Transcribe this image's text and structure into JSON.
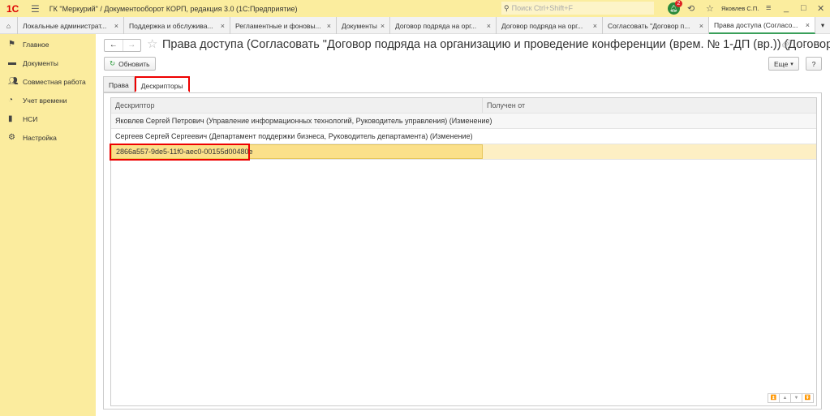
{
  "app": {
    "logo": "1С",
    "title": "ГК \"Меркурий\" / Документооборот КОРП, редакция 3.0  (1С:Предприятие)",
    "search_placeholder": "Поиск Ctrl+Shift+F",
    "notifications": "2",
    "user": "Яковлев С.П."
  },
  "tabs": [
    {
      "label": "Локальные администрат..."
    },
    {
      "label": "Поддержка и обслужива..."
    },
    {
      "label": "Регламентные и фоновы..."
    },
    {
      "label": "Документы"
    },
    {
      "label": "Договор подряда на орг..."
    },
    {
      "label": "Договор подряда на орг..."
    },
    {
      "label": "Согласовать \"Договор п..."
    },
    {
      "label": "Права доступа (Согласо..."
    }
  ],
  "sidebar": {
    "items": [
      {
        "label": "Главное"
      },
      {
        "label": "Документы"
      },
      {
        "label": "Совместная работа"
      },
      {
        "label": "Учет времени"
      },
      {
        "label": "НСИ"
      },
      {
        "label": "Настройка"
      }
    ]
  },
  "page": {
    "title": "Права доступа (Согласовать \"Договор подряда на организацию и проведение конференции (врем. № 1-ДП (вр.)) (Договор под...",
    "refresh": "Обновить",
    "more": "Еще",
    "help": "?"
  },
  "form_tabs": [
    {
      "label": "Права"
    },
    {
      "label": "Дескрипторы"
    }
  ],
  "table": {
    "columns": [
      "Дескриптор",
      "Получен от"
    ],
    "rows": [
      [
        "Яковлев Сергей Петрович (Управление информационных технологий, Руководитель управления) (Изменение)",
        ""
      ],
      [
        "Сергеев Сергей Сергеевич (Департамент поддержки бизнеса, Руководитель департамента) (Изменение)",
        ""
      ],
      [
        "2866a557-9de5-11f0-aec0-00155d00480e",
        ""
      ]
    ]
  }
}
